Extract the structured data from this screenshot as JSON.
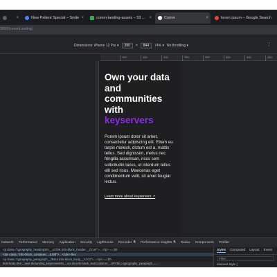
{
  "browser": {
    "tabs": [
      {
        "label": "",
        "icon": "tab-icon",
        "favicon_color": "#5f6368"
      },
      {
        "label": "New Patient Special – Smile",
        "icon": "tab-icon",
        "favicon_color": "#4285f4"
      },
      {
        "label": "comm-landing-assets – 53 ...",
        "icon": "tab-icon",
        "favicon_color": "#34a853"
      },
      {
        "label": "Comm",
        "icon": "tab-icon",
        "favicon_color": "#ffffff"
      },
      {
        "label": "lorem ipsum – Google Search",
        "icon": "tab-icon",
        "favicon_color": "#ea4335"
      }
    ],
    "address": "3000/(commLanding)"
  },
  "device_toolbar": {
    "dimensions_label": "Dimensions: iPhone 12 Pro ▾",
    "width": "390",
    "separator": "×",
    "height": "844",
    "zoom": "74% ▾",
    "throttle": "No throttling ▾"
  },
  "ruler_ticks": [
    "100",
    "150",
    "200",
    "250",
    "300",
    "350",
    "400",
    "450",
    "500"
  ],
  "page": {
    "headline_line1": "Own your data",
    "headline_line2": "and",
    "headline_line3": "communities",
    "headline_line4": "with",
    "headline_accent": "keyservers",
    "paragraph": "Porem ipsum dolor sit amet, consectetur adipiscing elit. Etiam eu turpis molesti, dictum est a, mattis tellus. Sed dignissim, metus nec fringilla accumsan, risus sem sollicitudin lacus, ut interdum tellus elit sed risus. Maecenas eget condimentum velit, sit amet feugiat lectus.",
    "learn_more": "Learn more about keyservers ↗"
  },
  "devtools": {
    "tabs": [
      "Elements",
      "Console",
      "Network",
      "Performance",
      "Memory",
      "Application",
      "Security",
      "Lighthouse",
      "Recorder ⚗",
      "Performance insights ⚗",
      "Redux",
      "Components",
      "Profiler"
    ],
    "selected_tab": "Elements",
    "dom_lines": [
      "<p class=\"typography_headingSm__xJ7bK info-block_header__GcuF\">…</p> == $0",
      "<div class=\"info-block_container__dJ9tf\">…</div> flex",
      "<p class=\"typography_paragraph__fRm2 info-block_body__A7c2\">…</p> == $0"
    ],
    "breadcrumb": "html  body  div#__next  div.landing_keyserverInfo__xxx  div.info-block_textContainer__UPYbk  p.typography_paragraph__…",
    "styles_tabs": [
      "Styles",
      "Computed",
      "Layout",
      "Event"
    ],
    "styles_selected": "Styles",
    "filter_placeholder": "Filter",
    "element_style": "element.style {"
  },
  "colors": {
    "accent": "#8a2be2",
    "devtools_bg": "#202124",
    "link_selected": "#8ab4f8"
  }
}
